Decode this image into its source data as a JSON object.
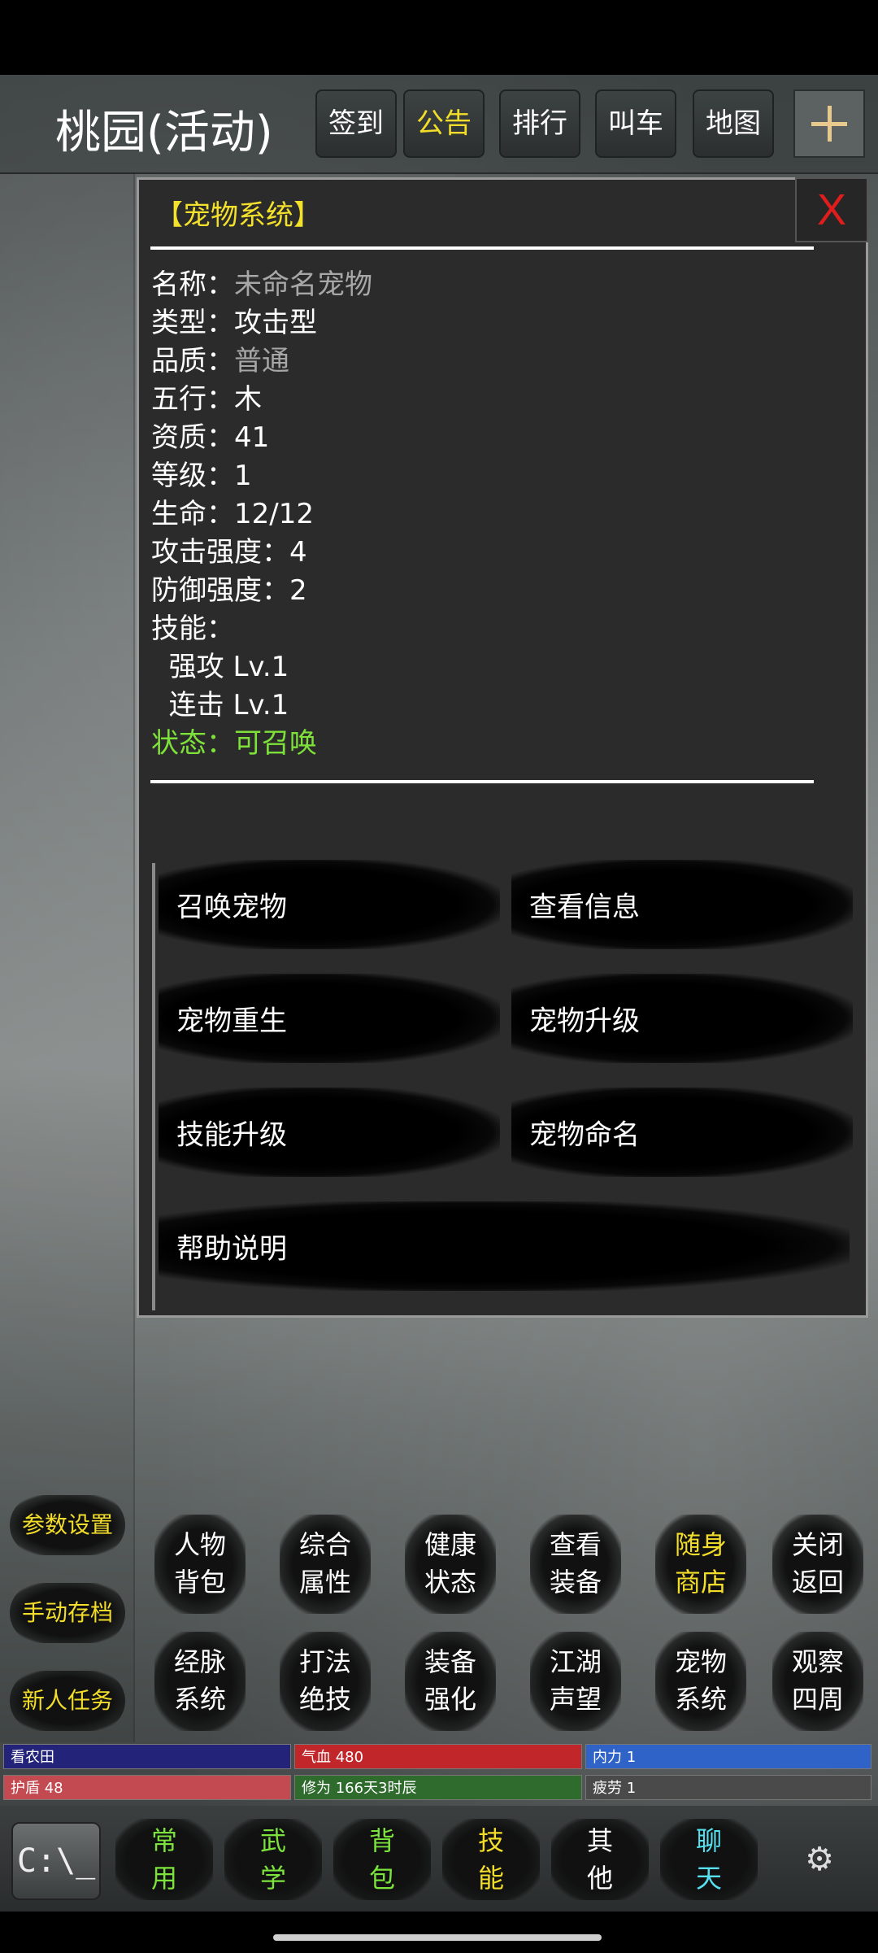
{
  "header": {
    "title": "桃园(活动)",
    "buttons": [
      {
        "label": "签到",
        "color": "#ffffff"
      },
      {
        "label": "公告",
        "color": "#f2dd2a"
      },
      {
        "label": "排行",
        "color": "#ffffff"
      },
      {
        "label": "叫车",
        "color": "#ffffff"
      },
      {
        "label": "地图",
        "color": "#ffffff"
      }
    ]
  },
  "panel": {
    "title": "【宠物系统】",
    "close": "X",
    "info": [
      {
        "key": "名称：",
        "value": "未命名宠物",
        "style": "grey"
      },
      {
        "key": "类型：",
        "value": "攻击型",
        "style": "white"
      },
      {
        "key": "品质：",
        "value": "普通",
        "style": "grey"
      },
      {
        "key": "五行：",
        "value": "木",
        "style": "white"
      },
      {
        "key": "资质：",
        "value": "41",
        "style": "white"
      },
      {
        "key": "等级：",
        "value": "1",
        "style": "white"
      },
      {
        "key": "生命：",
        "value": "12/12",
        "style": "white"
      },
      {
        "key": "攻击强度：",
        "value": "4",
        "style": "white"
      },
      {
        "key": "防御强度：",
        "value": "2",
        "style": "white"
      },
      {
        "key": "技能：",
        "value": "",
        "style": "white"
      },
      {
        "key": "  强攻 ",
        "value": "Lv.1",
        "style": "white"
      },
      {
        "key": "  连击 ",
        "value": "Lv.1",
        "style": "white"
      },
      {
        "key": "状态：",
        "value": "可召唤",
        "style": "green"
      }
    ],
    "actions": [
      "召唤宠物",
      "查看信息",
      "宠物重生",
      "宠物升级",
      "技能升级",
      "宠物命名",
      "帮助说明"
    ]
  },
  "side_buttons": [
    "参数设置",
    "手动存档",
    "新人任务"
  ],
  "grid": [
    {
      "l1": "人物",
      "l2": "背包",
      "hl": false
    },
    {
      "l1": "综合",
      "l2": "属性",
      "hl": false
    },
    {
      "l1": "健康",
      "l2": "状态",
      "hl": false
    },
    {
      "l1": "查看",
      "l2": "装备",
      "hl": false
    },
    {
      "l1": "随身",
      "l2": "商店",
      "hl": true
    },
    {
      "l1": "关闭",
      "l2": "返回",
      "hl": false
    },
    {
      "l1": "经脉",
      "l2": "系统",
      "hl": false
    },
    {
      "l1": "打法",
      "l2": "绝技",
      "hl": false
    },
    {
      "l1": "装备",
      "l2": "强化",
      "hl": false
    },
    {
      "l1": "江湖",
      "l2": "声望",
      "hl": false
    },
    {
      "l1": "宠物",
      "l2": "系统",
      "hl": false
    },
    {
      "l1": "观察",
      "l2": "四周",
      "hl": false
    }
  ],
  "stats": [
    {
      "label": "看农田",
      "color": "#23237a"
    },
    {
      "label": "气血 480",
      "color": "#c0262a"
    },
    {
      "label": "内力 1",
      "color": "#2f63c8"
    },
    {
      "label": "护盾 48",
      "color": "#c24a50"
    },
    {
      "label": "修为 166天3时辰",
      "color": "#2e6b2c"
    },
    {
      "label": "疲劳 1",
      "color": "#4a4a4a"
    }
  ],
  "bottom_tabs": [
    {
      "l1": "常",
      "l2": "用",
      "color": "#7be33b"
    },
    {
      "l1": "武",
      "l2": "学",
      "color": "#7be33b"
    },
    {
      "l1": "背",
      "l2": "包",
      "color": "#7be33b"
    },
    {
      "l1": "技",
      "l2": "能",
      "color": "#f2dd2a"
    },
    {
      "l1": "其",
      "l2": "他",
      "color": "#ffffff"
    },
    {
      "l1": "聊",
      "l2": "天",
      "color": "#56e0f0"
    }
  ],
  "bottom_icons": {
    "cmd": "C:\\_",
    "gear": "⚙"
  }
}
